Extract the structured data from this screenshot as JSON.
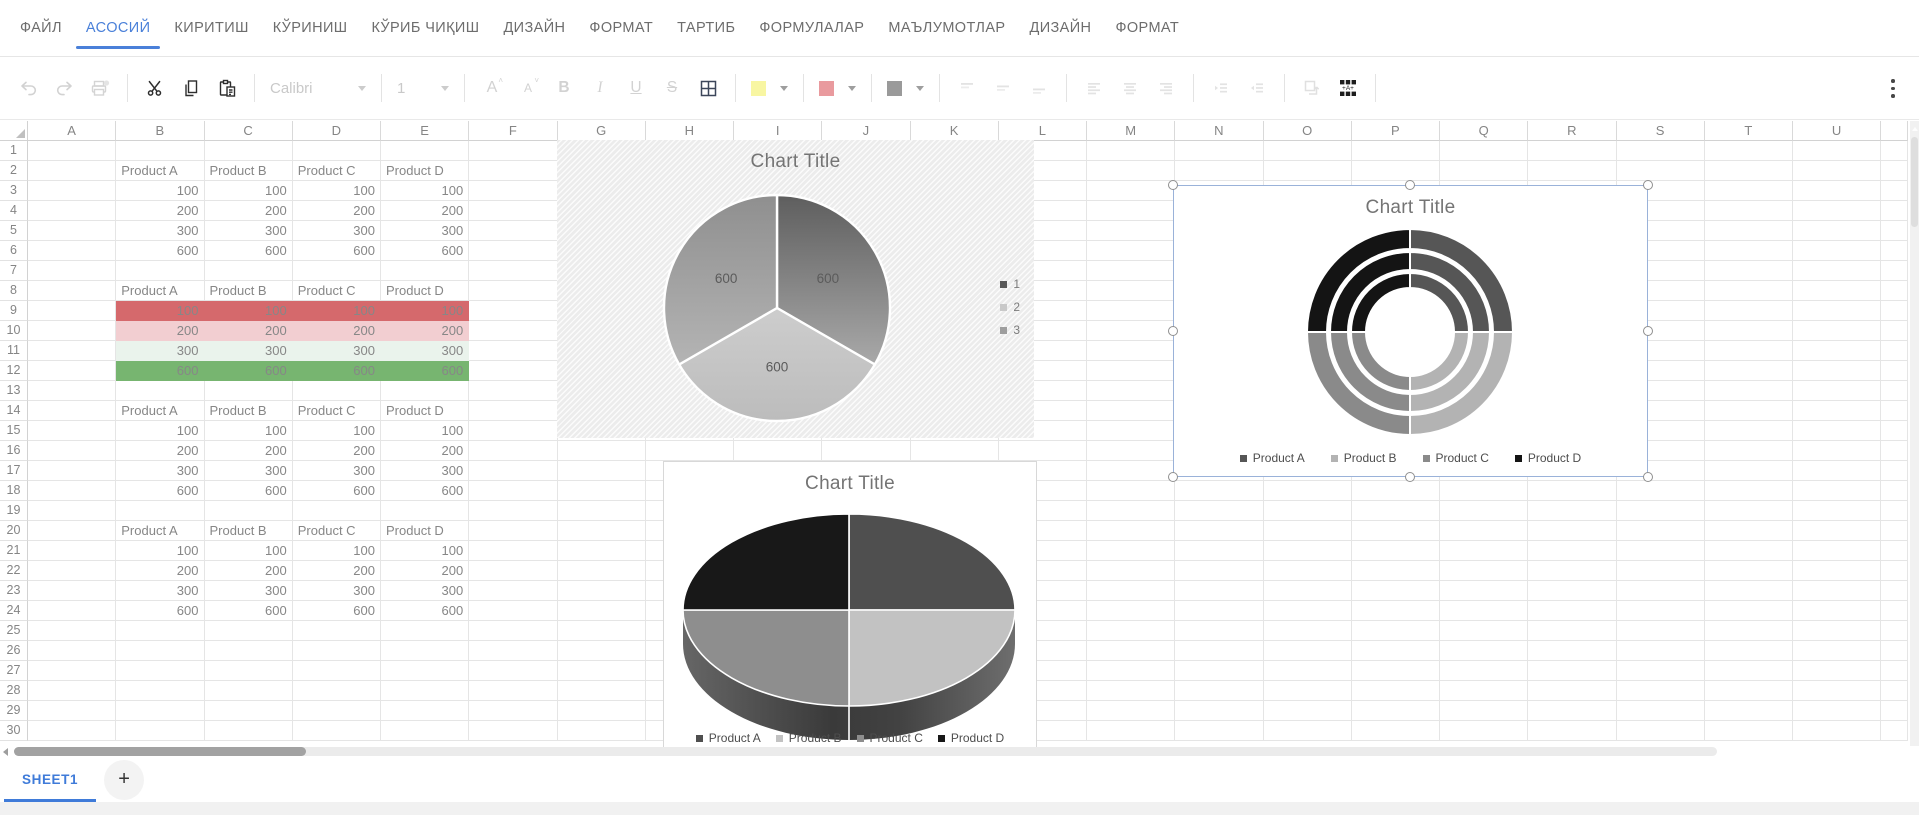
{
  "menu": {
    "tabs": [
      {
        "label": "ФАЙЛ",
        "active": false
      },
      {
        "label": "АСОСИЙ",
        "active": true
      },
      {
        "label": "КИРИТИШ",
        "active": false
      },
      {
        "label": "КЎРИНИШ",
        "active": false
      },
      {
        "label": "КЎРИБ ЧИҚИШ",
        "active": false
      },
      {
        "label": "ДИЗАЙН",
        "active": false
      },
      {
        "label": "ФОРМАТ",
        "active": false
      },
      {
        "label": "ТАРТИБ",
        "active": false
      },
      {
        "label": "ФОРМУЛАЛАР",
        "active": false
      },
      {
        "label": "МАЪЛУМОТЛАР",
        "active": false
      },
      {
        "label": "ДИЗАЙН",
        "active": false
      },
      {
        "label": "ФОРМАТ",
        "active": false
      }
    ],
    "accent_color": "#4a80d9"
  },
  "toolbar": {
    "font_name": "Calibri",
    "font_size": "1",
    "grow_font": "A",
    "shrink_font": "A",
    "bold": "B",
    "italic": "I",
    "underline": "U",
    "strikethrough": "S",
    "table_icon_text": "+A+",
    "swatch_colors": {
      "fill": "#f8f6a2",
      "font": "#e99a9e",
      "border": "#9a9a9a"
    }
  },
  "grid": {
    "column_labels": [
      "A",
      "B",
      "C",
      "D",
      "E",
      "F",
      "G",
      "H",
      "I",
      "J",
      "K",
      "L",
      "M",
      "N",
      "O",
      "P",
      "Q",
      "R",
      "S",
      "T",
      "U"
    ],
    "row_count": 30,
    "tables": [
      {
        "start_row": 2,
        "start_col": "B",
        "headers": [
          "Product A",
          "Product B",
          "Product C",
          "Product D"
        ],
        "rows": [
          [
            "100",
            "100",
            "100",
            "100"
          ],
          [
            "200",
            "200",
            "200",
            "200"
          ],
          [
            "300",
            "300",
            "300",
            "300"
          ],
          [
            "600",
            "600",
            "600",
            "600"
          ]
        ],
        "row_fills": [
          null,
          null,
          null,
          null
        ]
      },
      {
        "start_row": 8,
        "start_col": "B",
        "headers": [
          "Product A",
          "Product B",
          "Product C",
          "Product D"
        ],
        "rows": [
          [
            "100",
            "100",
            "100",
            "100"
          ],
          [
            "200",
            "200",
            "200",
            "200"
          ],
          [
            "300",
            "300",
            "300",
            "300"
          ],
          [
            "600",
            "600",
            "600",
            "600"
          ]
        ],
        "row_fills": [
          "#d5696c",
          "#f2ced1",
          "#eaf3ec",
          "#77b570"
        ]
      },
      {
        "start_row": 14,
        "start_col": "B",
        "headers": [
          "Product A",
          "Product B",
          "Product C",
          "Product D"
        ],
        "rows": [
          [
            "100",
            "100",
            "100",
            "100"
          ],
          [
            "200",
            "200",
            "200",
            "200"
          ],
          [
            "300",
            "300",
            "300",
            "300"
          ],
          [
            "600",
            "600",
            "600",
            "600"
          ]
        ],
        "row_fills": [
          null,
          null,
          null,
          null
        ]
      },
      {
        "start_row": 20,
        "start_col": "B",
        "headers": [
          "Product A",
          "Product B",
          "Product C",
          "Product D"
        ],
        "rows": [
          [
            "100",
            "100",
            "100",
            "100"
          ],
          [
            "200",
            "200",
            "200",
            "200"
          ],
          [
            "300",
            "300",
            "300",
            "300"
          ],
          [
            "600",
            "600",
            "600",
            "600"
          ]
        ],
        "row_fills": [
          null,
          null,
          null,
          null
        ]
      }
    ]
  },
  "chart_data": [
    {
      "type": "pie",
      "title": "Chart Title",
      "labels": [
        "1",
        "2",
        "3"
      ],
      "values": [
        600,
        600,
        600
      ],
      "data_labels": [
        "600",
        "600",
        "600"
      ],
      "legend_position": "right",
      "background": "diagonal-hatch",
      "slice_colors_top": [
        "#5e5e5e",
        "#cdcdcd",
        "#8f8f8f"
      ],
      "slice_colors_bottom": [
        "#a9a9a9",
        "#bcbcbc",
        "#b4b4b4"
      ],
      "legend_colors": [
        "#595959",
        "#c9c9c9",
        "#9e9e9e"
      ]
    },
    {
      "type": "doughnut",
      "title": "Chart Title",
      "categories": [
        "Product A",
        "Product B",
        "Product C",
        "Product D"
      ],
      "series": [
        [
          100,
          100,
          100,
          100
        ],
        [
          200,
          200,
          200,
          200
        ],
        [
          300,
          300,
          300,
          300
        ]
      ],
      "category_colors": [
        "#565656",
        "#b3b3b3",
        "#8a8a8a",
        "#141414"
      ],
      "legend_position": "bottom",
      "selected": true
    },
    {
      "type": "pie3d",
      "title": "Chart Title",
      "categories": [
        "Product A",
        "Product B",
        "Product C",
        "Product D"
      ],
      "values": [
        600,
        600,
        600,
        600
      ],
      "category_colors": [
        "#4f4f4f",
        "#c2c2c2",
        "#8e8e8e",
        "#181818"
      ],
      "legend_position": "bottom"
    }
  ],
  "sheet_bar": {
    "tabs": [
      {
        "label": "SHEET1",
        "active": true
      }
    ],
    "add_button": "+"
  }
}
